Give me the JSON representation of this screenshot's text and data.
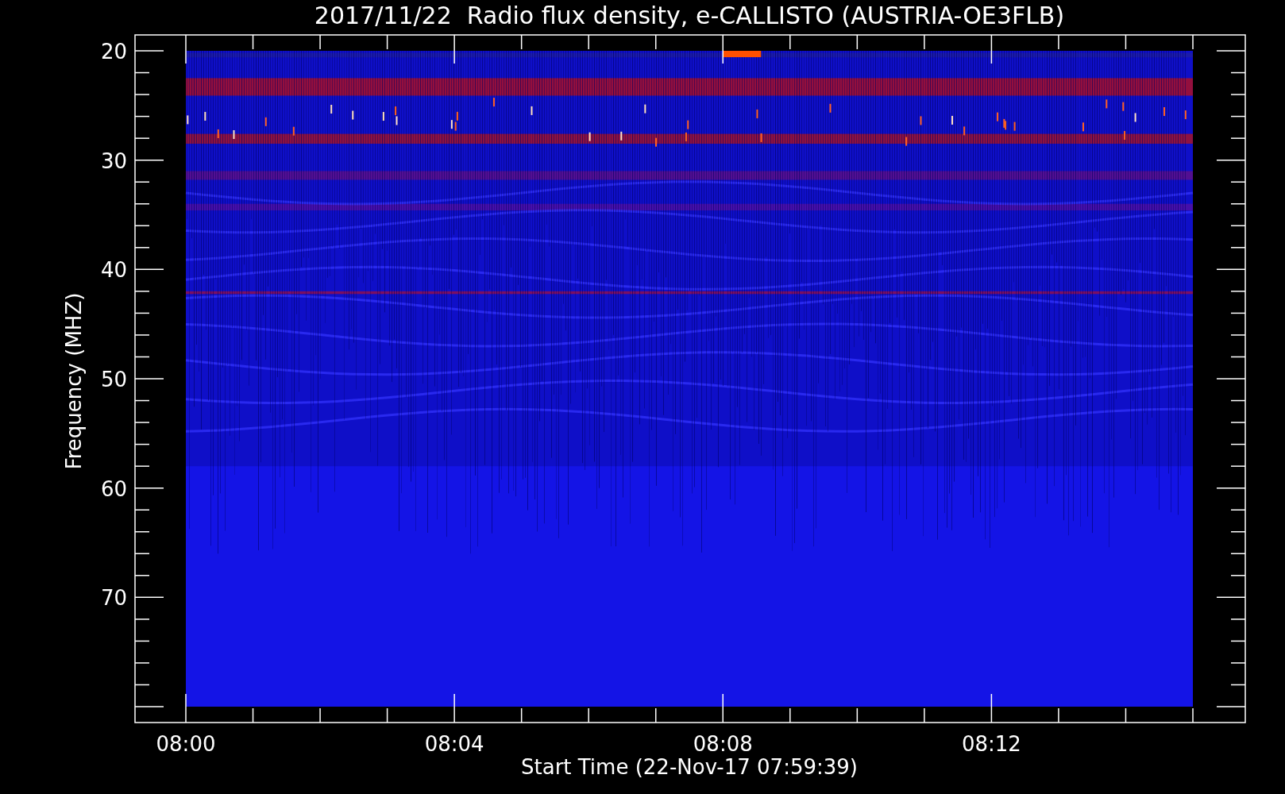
{
  "plot": {
    "title": "2017/11/22  Radio flux density, e-CALLISTO (AUSTRIA-OE3FLB)",
    "ylabel": "Frequency (MHZ)",
    "xlabel": "Start Time (22-Nov-17 07:59:39)",
    "yticks": [
      "20",
      "30",
      "40",
      "50",
      "60",
      "70"
    ],
    "xticks": [
      "08:00",
      "08:04",
      "08:08",
      "08:12"
    ]
  }
}
